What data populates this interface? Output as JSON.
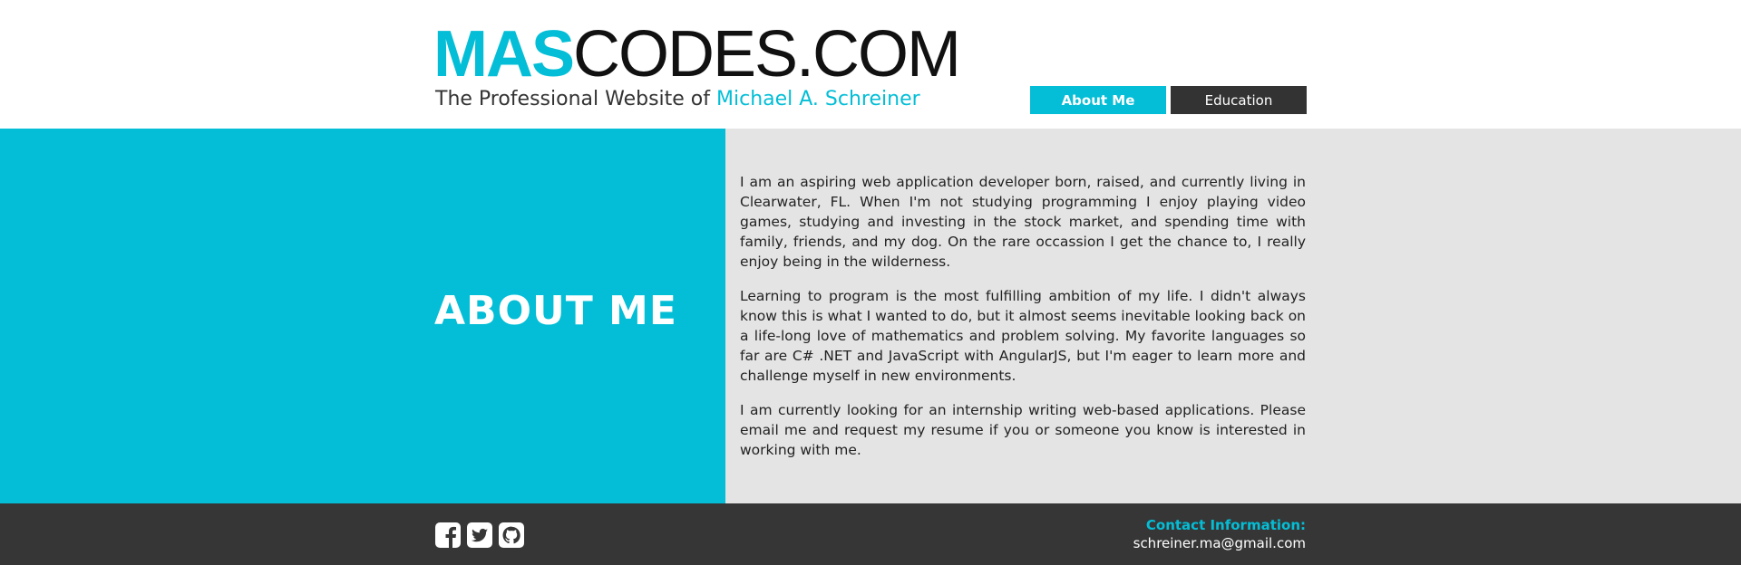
{
  "header": {
    "logo_accent": "MAS",
    "logo_rest": "CODES.COM",
    "tagline_prefix": "The Professional Website of ",
    "tagline_name": "Michael A. Schreiner"
  },
  "nav": {
    "items": [
      {
        "label": "About Me",
        "active": true
      },
      {
        "label": "Education",
        "active": false
      }
    ]
  },
  "main": {
    "heading": "ABOUT ME",
    "paragraphs": [
      "I am an aspiring web application developer born, raised, and currently living in Clearwater, FL. When I'm not studying programming I enjoy playing video games, studying and investing in the stock market, and spending time with family, friends, and my dog. On the rare occassion I get the chance to, I really enjoy being in the wilderness.",
      "Learning to program is the most fulfilling ambition of my life. I didn't always know this is what I wanted to do, but it almost seems inevitable looking back on a life-long love of mathematics and problem solving. My favorite languages so far are C# .NET and JavaScript with AngularJS, but I'm eager to learn more and challenge myself in new environments.",
      "I am currently looking for an internship writing web-based applications. Please email me and request my resume if you or someone you know is interested in working with me."
    ]
  },
  "footer": {
    "social_icons": [
      "facebook-icon",
      "twitter-icon",
      "github-icon"
    ],
    "contact_label": "Contact Information:",
    "contact_email": "schreiner.ma@gmail.com"
  },
  "colors": {
    "accent": "#03bed6",
    "dark": "#363636",
    "panel": "#e4e4e4"
  }
}
